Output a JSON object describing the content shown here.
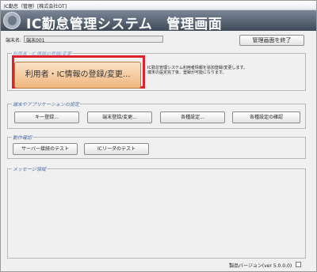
{
  "window": {
    "title": "IC勤怠（管理）[株式会社OT]"
  },
  "banner": {
    "title_left": "IC勤怠管理システム",
    "title_right": "管理画面",
    "icon": "app-logo-icon"
  },
  "device": {
    "label": "端末名:",
    "value": "端末001"
  },
  "toolbar": {
    "exit_label": "管理画面を終了"
  },
  "user_group": {
    "label": "利用者・IC情報の登録/変更",
    "button_label": "利用者・IC情報の登録/変更...",
    "description_line1": "IC勤怠管理システム利用者情報を追加登録/変更します。",
    "description_line2": "端末の設定完了後、登録が可能になります。",
    "highlight_color": "#e0202e"
  },
  "settings_group": {
    "label": "端末やアプリケーションの設定",
    "buttons": [
      "キー登録...",
      "端末登録/変更...",
      "各種設定...",
      "各種設定の確認"
    ]
  },
  "test_group": {
    "label": "動作確認",
    "buttons": [
      "サーバー接続のテスト",
      "ICリーダのテスト"
    ]
  },
  "message_group": {
    "label": "メッセージ領域"
  },
  "footer": {
    "version": "製品バージョン(ver 5.0.0.0)"
  }
}
